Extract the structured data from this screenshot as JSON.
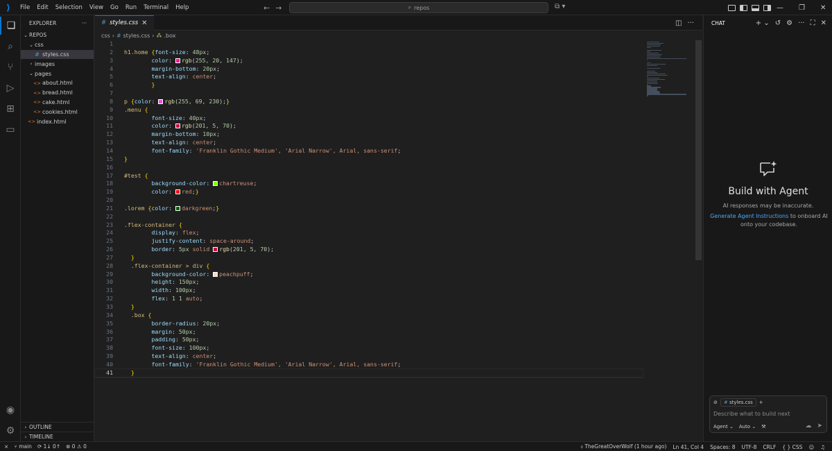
{
  "window": {
    "menus": [
      "File",
      "Edit",
      "Selection",
      "View",
      "Go",
      "Run",
      "Terminal",
      "Help"
    ],
    "search_text": "repos"
  },
  "explorer": {
    "header": "EXPLORER",
    "more": "···",
    "root": "REPOS",
    "items": [
      {
        "label": "css",
        "kind": "folder",
        "open": true,
        "depth": 1
      },
      {
        "label": "styles.css",
        "kind": "css",
        "depth": 2,
        "selected": true
      },
      {
        "label": "images",
        "kind": "folder",
        "open": false,
        "depth": 1
      },
      {
        "label": "pages",
        "kind": "folder",
        "open": true,
        "depth": 1
      },
      {
        "label": "about.html",
        "kind": "html",
        "depth": 2
      },
      {
        "label": "bread.html",
        "kind": "html",
        "depth": 2
      },
      {
        "label": "cake.html",
        "kind": "html",
        "depth": 2
      },
      {
        "label": "cookies.html",
        "kind": "html",
        "depth": 2
      },
      {
        "label": "index.html",
        "kind": "html",
        "depth": 1
      }
    ],
    "outline": "OUTLINE",
    "timeline": "TIMELINE"
  },
  "editor": {
    "tab_label": "styles.css",
    "breadcrumb": [
      "css",
      "styles.css",
      ".box"
    ],
    "lines": [
      [],
      [
        [
          "s",
          "h1.home "
        ],
        [
          "b",
          "{"
        ],
        [
          "p",
          "font-size"
        ],
        [
          "u",
          ": "
        ],
        [
          "n",
          "48px"
        ],
        [
          "u",
          ";"
        ]
      ],
      [
        [
          "i",
          "        "
        ],
        [
          "p",
          "color"
        ],
        [
          "u",
          ": "
        ],
        [
          "c",
          "#ff1493"
        ],
        [
          "f",
          "rgb"
        ],
        [
          "u",
          "("
        ],
        [
          "n",
          "255, 20, 147"
        ],
        [
          "u",
          ");"
        ]
      ],
      [
        [
          "i",
          "        "
        ],
        [
          "p",
          "margin-bottom"
        ],
        [
          "u",
          ": "
        ],
        [
          "n",
          "20px"
        ],
        [
          "u",
          ";"
        ]
      ],
      [
        [
          "i",
          "        "
        ],
        [
          "p",
          "text-align"
        ],
        [
          "u",
          ": "
        ],
        [
          "v",
          "center"
        ],
        [
          "u",
          ";"
        ]
      ],
      [
        [
          "i",
          "        "
        ],
        [
          "b",
          "}"
        ]
      ],
      [],
      [
        [
          "s",
          "p "
        ],
        [
          "b",
          "{"
        ],
        [
          "p",
          "color"
        ],
        [
          "u",
          ": "
        ],
        [
          "c",
          "#ff45e6"
        ],
        [
          "f",
          "rgb"
        ],
        [
          "u",
          "("
        ],
        [
          "n",
          "255, 69, 230"
        ],
        [
          "u",
          ");"
        ],
        [
          "b",
          "}"
        ]
      ],
      [
        [
          "s",
          ".menu "
        ],
        [
          "b",
          "{"
        ]
      ],
      [
        [
          "i",
          "        "
        ],
        [
          "p",
          "font-size"
        ],
        [
          "u",
          ": "
        ],
        [
          "n",
          "40px"
        ],
        [
          "u",
          ";"
        ]
      ],
      [
        [
          "i",
          "        "
        ],
        [
          "p",
          "color"
        ],
        [
          "u",
          ": "
        ],
        [
          "c",
          "#c90546"
        ],
        [
          "f",
          "rgb"
        ],
        [
          "u",
          "("
        ],
        [
          "n",
          "201, 5, 70"
        ],
        [
          "u",
          ");"
        ]
      ],
      [
        [
          "i",
          "        "
        ],
        [
          "p",
          "margin-bottom"
        ],
        [
          "u",
          ": "
        ],
        [
          "n",
          "10px"
        ],
        [
          "u",
          ";"
        ]
      ],
      [
        [
          "i",
          "        "
        ],
        [
          "p",
          "text-align"
        ],
        [
          "u",
          ": "
        ],
        [
          "v",
          "center"
        ],
        [
          "u",
          ";"
        ]
      ],
      [
        [
          "i",
          "        "
        ],
        [
          "p",
          "font-family"
        ],
        [
          "u",
          ": "
        ],
        [
          "v",
          "'Franklin Gothic Medium', 'Arial Narrow', Arial, sans-serif"
        ],
        [
          "u",
          ";"
        ]
      ],
      [
        [
          "b",
          "}"
        ]
      ],
      [],
      [
        [
          "s",
          "#test "
        ],
        [
          "b",
          "{"
        ]
      ],
      [
        [
          "i",
          "        "
        ],
        [
          "p",
          "background-color"
        ],
        [
          "u",
          ": "
        ],
        [
          "c",
          "#7fff00"
        ],
        [
          "v",
          "chartreuse"
        ],
        [
          "u",
          ";"
        ]
      ],
      [
        [
          "i",
          "        "
        ],
        [
          "p",
          "color"
        ],
        [
          "u",
          ": "
        ],
        [
          "c",
          "#ff0000"
        ],
        [
          "v",
          "red"
        ],
        [
          "u",
          ";"
        ],
        [
          "b",
          "}"
        ]
      ],
      [],
      [
        [
          "s",
          ".lorem "
        ],
        [
          "b",
          "{"
        ],
        [
          "p",
          "color"
        ],
        [
          "u",
          ": "
        ],
        [
          "c",
          "#006400"
        ],
        [
          "v",
          "darkgreen"
        ],
        [
          "u",
          ";"
        ],
        [
          "b",
          "}"
        ]
      ],
      [],
      [
        [
          "s",
          ".flex-container "
        ],
        [
          "b",
          "{"
        ]
      ],
      [
        [
          "i",
          "        "
        ],
        [
          "p",
          "display"
        ],
        [
          "u",
          ": "
        ],
        [
          "v",
          "flex"
        ],
        [
          "u",
          ";"
        ]
      ],
      [
        [
          "i",
          "        "
        ],
        [
          "p",
          "justify-content"
        ],
        [
          "u",
          ": "
        ],
        [
          "v",
          "space-around"
        ],
        [
          "u",
          ";"
        ]
      ],
      [
        [
          "i",
          "        "
        ],
        [
          "p",
          "border"
        ],
        [
          "u",
          ": "
        ],
        [
          "n",
          "5px"
        ],
        [
          "v",
          " solid "
        ],
        [
          "c",
          "#c90546"
        ],
        [
          "f",
          "rgb"
        ],
        [
          "u",
          "("
        ],
        [
          "n",
          "201, 5, 70"
        ],
        [
          "u",
          ");"
        ]
      ],
      [
        [
          "i",
          "  "
        ],
        [
          "b",
          "}"
        ]
      ],
      [
        [
          "i",
          "  "
        ],
        [
          "s",
          ".flex-container > div "
        ],
        [
          "b",
          "{"
        ]
      ],
      [
        [
          "i",
          "        "
        ],
        [
          "p",
          "background-color"
        ],
        [
          "u",
          ": "
        ],
        [
          "c",
          "#ffdab9"
        ],
        [
          "v",
          "peachpuff"
        ],
        [
          "u",
          ";"
        ]
      ],
      [
        [
          "i",
          "        "
        ],
        [
          "p",
          "height"
        ],
        [
          "u",
          ": "
        ],
        [
          "n",
          "150px"
        ],
        [
          "u",
          ";"
        ]
      ],
      [
        [
          "i",
          "        "
        ],
        [
          "p",
          "width"
        ],
        [
          "u",
          ": "
        ],
        [
          "n",
          "100px"
        ],
        [
          "u",
          ";"
        ]
      ],
      [
        [
          "i",
          "        "
        ],
        [
          "p",
          "flex"
        ],
        [
          "u",
          ": "
        ],
        [
          "n",
          "1 1"
        ],
        [
          "v",
          " auto"
        ],
        [
          "u",
          ";"
        ]
      ],
      [
        [
          "i",
          "  "
        ],
        [
          "b",
          "}"
        ]
      ],
      [
        [
          "i",
          "  "
        ],
        [
          "s",
          ".box "
        ],
        [
          "b",
          "{"
        ]
      ],
      [
        [
          "i",
          "        "
        ],
        [
          "p",
          "border-radius"
        ],
        [
          "u",
          ": "
        ],
        [
          "n",
          "20px"
        ],
        [
          "u",
          ";"
        ]
      ],
      [
        [
          "i",
          "        "
        ],
        [
          "p",
          "margin"
        ],
        [
          "u",
          ": "
        ],
        [
          "n",
          "50px"
        ],
        [
          "u",
          ";"
        ]
      ],
      [
        [
          "i",
          "        "
        ],
        [
          "p",
          "padding"
        ],
        [
          "u",
          ": "
        ],
        [
          "n",
          "50px"
        ],
        [
          "u",
          ";"
        ]
      ],
      [
        [
          "i",
          "        "
        ],
        [
          "p",
          "font-size"
        ],
        [
          "u",
          ": "
        ],
        [
          "n",
          "100px"
        ],
        [
          "u",
          ";"
        ]
      ],
      [
        [
          "i",
          "        "
        ],
        [
          "p",
          "text-align"
        ],
        [
          "u",
          ": "
        ],
        [
          "v",
          "center"
        ],
        [
          "u",
          ";"
        ]
      ],
      [
        [
          "i",
          "        "
        ],
        [
          "p",
          "font-family"
        ],
        [
          "u",
          ": "
        ],
        [
          "v",
          "'Franklin Gothic Medium', 'Arial Narrow', Arial, sans-serif"
        ],
        [
          "u",
          ";"
        ]
      ],
      [
        [
          "i",
          "  "
        ],
        [
          "b",
          "}"
        ]
      ]
    ],
    "current_line": 41
  },
  "chat": {
    "header": "CHAT",
    "title": "Build with Agent",
    "warning": "AI responses may be inaccurate.",
    "onboard_link": "Generate Agent Instructions",
    "onboard_rest": " to onboard AI onto your codebase.",
    "context_file": "styles.css",
    "input_placeholder": "Describe what to build next",
    "mode": "Agent",
    "model": "Auto"
  },
  "statusbar": {
    "branch": "main",
    "sync": "1↓ 0↑",
    "errors": "0",
    "warnings": "0",
    "author": "TheGreatOverWolf (1 hour ago)",
    "position": "Ln 41, Col 4",
    "spaces": "Spaces: 8",
    "encoding": "UTF-8",
    "eol": "CRLF",
    "language": "CSS"
  }
}
